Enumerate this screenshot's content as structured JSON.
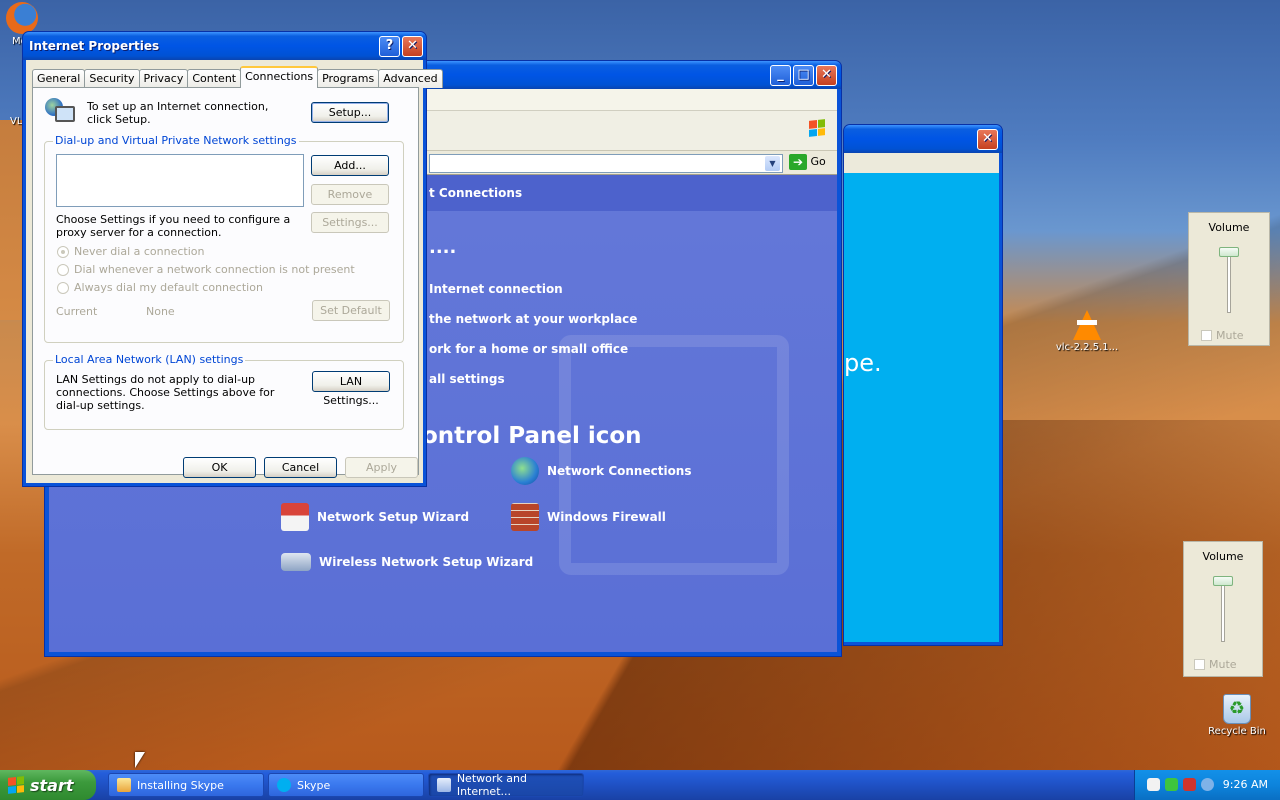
{
  "desktop": {
    "icons": [
      {
        "label": "Moz"
      },
      {
        "label": "vlc-2.2.5.1..."
      },
      {
        "label": "Recycle Bin"
      }
    ],
    "side_label": "VL"
  },
  "control_panel_window": {
    "go_label": "Go",
    "header_fragment": "t Connections",
    "dots": "....",
    "tasks": [
      "Internet connection",
      "the network at your workplace",
      "ork for a home or small office",
      "all settings"
    ],
    "section_title": "ontrol Panel icon",
    "icons": {
      "network_connections": "Network Connections",
      "network_setup_wizard": "Network Setup Wizard",
      "windows_firewall": "Windows Firewall",
      "wireless_setup_wizard": "Wireless Network Setup Wizard"
    }
  },
  "skype_window": {
    "text_fragment": "pe."
  },
  "internet_properties": {
    "title": "Internet Properties",
    "tabs": [
      "General",
      "Security",
      "Privacy",
      "Content",
      "Connections",
      "Programs",
      "Advanced"
    ],
    "active_tab": "Connections",
    "setup_text": "To set up an Internet connection, click Setup.",
    "setup_button": "Setup...",
    "dialup_group_title": "Dial-up and Virtual Private Network settings",
    "add_button": "Add...",
    "remove_button": "Remove",
    "settings_button": "Settings...",
    "proxy_text": "Choose Settings if you need to configure a proxy server for a connection.",
    "radios": [
      "Never dial a connection",
      "Dial whenever a network connection is not present",
      "Always dial my default connection"
    ],
    "current_label": "Current",
    "current_value": "None",
    "set_default_button": "Set Default",
    "lan_group_title": "Local Area Network (LAN) settings",
    "lan_text": "LAN Settings do not apply to dial-up connections. Choose Settings above for dial-up settings.",
    "lan_button": "LAN Settings...",
    "ok_button": "OK",
    "cancel_button": "Cancel",
    "apply_button": "Apply",
    "help_symbol": "?",
    "close_symbol": "✕"
  },
  "volume_panels": [
    {
      "title": "Volume",
      "mute_label": "Mute"
    },
    {
      "title": "Volume",
      "mute_label": "Mute"
    }
  ],
  "taskbar": {
    "start_label": "start",
    "tasks": [
      {
        "label": "Installing Skype"
      },
      {
        "label": "Skype"
      },
      {
        "label": "Network and Internet..."
      }
    ],
    "clock": "9:26 AM"
  },
  "colors": {
    "xp_blue": "#0055e5",
    "start_green": "#3c9a3c",
    "panel_blue": "#5a6fd6",
    "skype_blue": "#00aff0"
  }
}
